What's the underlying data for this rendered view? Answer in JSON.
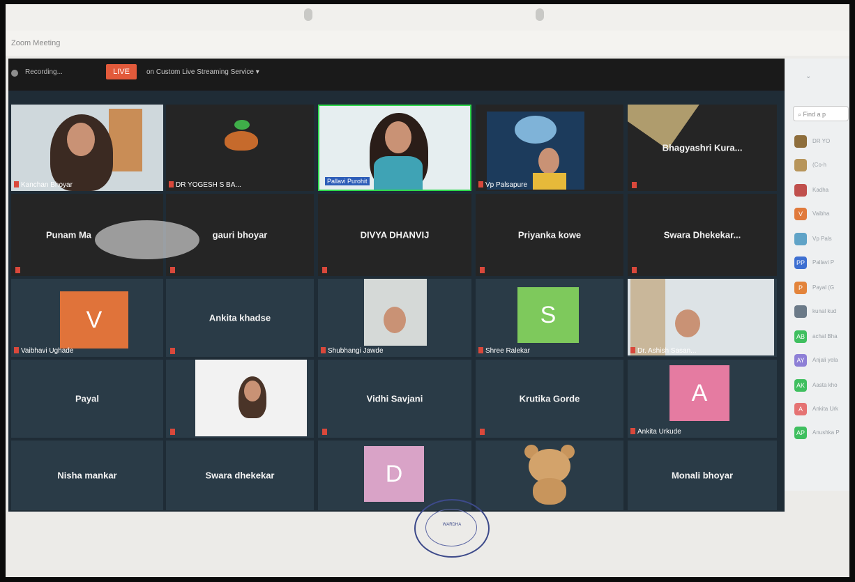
{
  "window": {
    "title": "Zoom Meeting"
  },
  "topbar": {
    "recording": "Recording...",
    "live": "LIVE",
    "stream": "on Custom Live Streaming Service ▾"
  },
  "tiles": {
    "r1": [
      "Kanchan Bhoyar",
      "DR YOGESH S BA...",
      "Pallavi Purohit",
      "Vp Palsapure",
      "Bhagyashri Kura..."
    ],
    "r2": [
      "Punam Ma",
      "gauri bhoyar",
      "DIVYA DHANVIJ",
      "Priyanka kowe",
      "Swara Dhekekar..."
    ],
    "r3": [
      "Vaibhavi Ughade",
      "Ankita khadse",
      "Shubhangi Jawde",
      "Shree Ralekar",
      "Dr. Ashish Sasan..."
    ],
    "r4": [
      "Payal",
      "",
      "Vidhi Savjani",
      "Krutika Gorde",
      "Ankita Urkude"
    ],
    "r5": [
      "Nisha mankar",
      "Swara dhekekar",
      "",
      "",
      "Monali bhoyar"
    ]
  },
  "avatars": {
    "v": "V",
    "s": "S",
    "a": "A",
    "d": "D"
  },
  "side": {
    "search": "Find a p",
    "items": [
      {
        "label": "DR YO",
        "color": "#8e6e3c",
        "initials": ""
      },
      {
        "label": "(Co-h",
        "color": "#b7955a",
        "initials": ""
      },
      {
        "label": "Kadha",
        "color": "#c0504d",
        "initials": ""
      },
      {
        "label": "Vaibha",
        "color": "#e07a3c",
        "initials": "V"
      },
      {
        "label": "Vp Pals",
        "color": "#5fa3c7",
        "initials": ""
      },
      {
        "label": "Pallavi P",
        "color": "#3d6fd1",
        "initials": "PP"
      },
      {
        "label": "Payal (G",
        "color": "#e3843b",
        "initials": "P"
      },
      {
        "label": "kunal kud",
        "color": "#6b7a88",
        "initials": ""
      },
      {
        "label": "achal Bha",
        "color": "#3fbf5f",
        "initials": "AB"
      },
      {
        "label": "Anjali yela",
        "color": "#8d7fd6",
        "initials": "AY"
      },
      {
        "label": "Aasta kho",
        "color": "#3fbf5f",
        "initials": "AK"
      },
      {
        "label": "Ankita Urk",
        "color": "#e57373",
        "initials": "A"
      },
      {
        "label": "Anushka P",
        "color": "#3fbf5f",
        "initials": "AP"
      }
    ]
  },
  "stamp": {
    "text": "WARDHA"
  },
  "colors": {
    "live": "#e25a3b",
    "active_speaker": "#2fd84b",
    "muted": "#d9483b"
  }
}
